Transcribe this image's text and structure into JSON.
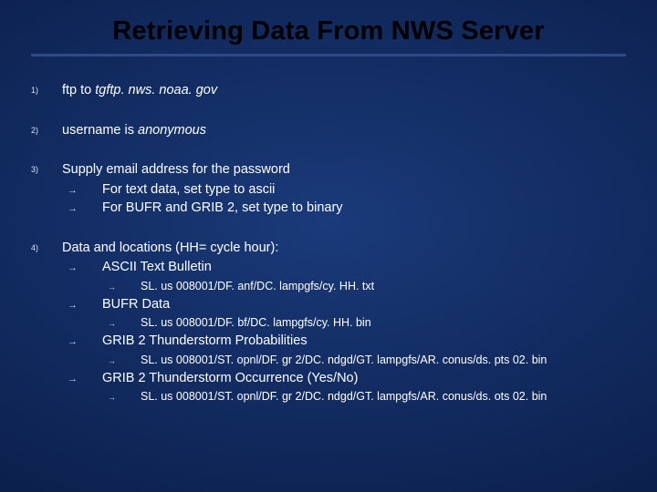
{
  "title": "Retrieving Data From NWS Server",
  "items": [
    {
      "num": "1)",
      "lead_pre": "ftp to ",
      "lead_em": "tgftp. nws. noaa. gov",
      "lead_post": ""
    },
    {
      "num": "2)",
      "lead_pre": "username is ",
      "lead_em": "anonymous",
      "lead_post": ""
    },
    {
      "num": "3)",
      "lead": "Supply email address for the password",
      "sub": [
        {
          "text": "For text data, set type to ascii"
        },
        {
          "text": "For BUFR and GRIB 2, set type to binary"
        }
      ]
    },
    {
      "num": "4)",
      "lead": "Data and locations (HH= cycle hour):",
      "sub4": [
        {
          "label": "ASCII Text Bulletin",
          "paths": [
            "SL. us 008001/DF. anf/DC. lampgfs/cy. HH. txt"
          ]
        },
        {
          "label": "BUFR Data",
          "paths": [
            "SL. us 008001/DF. bf/DC. lampgfs/cy. HH. bin"
          ]
        },
        {
          "label": "GRIB 2 Thunderstorm Probabilities",
          "paths": [
            "SL. us 008001/ST. opnl/DF. gr 2/DC. ndgd/GT. lampgfs/AR. conus/ds. pts 02. bin"
          ]
        },
        {
          "label": "GRIB 2 Thunderstorm Occurrence (Yes/No)",
          "paths": [
            "SL. us 008001/ST. opnl/DF. gr 2/DC. ndgd/GT. lampgfs/AR. conus/ds. ots 02. bin"
          ]
        }
      ]
    }
  ],
  "arrow": "→"
}
